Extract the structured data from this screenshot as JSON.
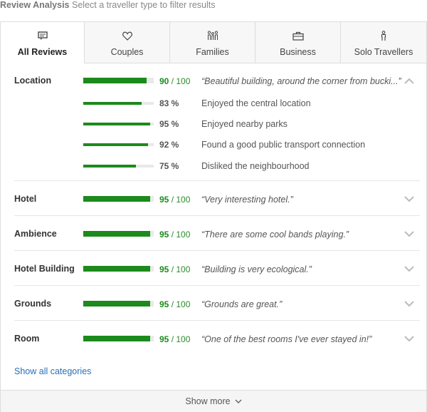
{
  "heading": {
    "title": "Review Analysis",
    "subtitle": "Select a traveller type to filter results"
  },
  "tabs": [
    {
      "label": "All Reviews",
      "icon": "review-icon",
      "active": true
    },
    {
      "label": "Couples",
      "icon": "heart-icon",
      "active": false
    },
    {
      "label": "Families",
      "icon": "family-icon",
      "active": false
    },
    {
      "label": "Business",
      "icon": "briefcase-icon",
      "active": false
    },
    {
      "label": "Solo Travellers",
      "icon": "person-icon",
      "active": false
    }
  ],
  "categories": [
    {
      "name": "Location",
      "score": "90",
      "max": "/ 100",
      "quote": "“Beautiful building, around the corner from bucki...”",
      "expanded": true,
      "subs": [
        {
          "pct": "83 %",
          "value": 83,
          "text": "Enjoyed the central location"
        },
        {
          "pct": "95 %",
          "value": 95,
          "text": "Enjoyed nearby parks"
        },
        {
          "pct": "92 %",
          "value": 92,
          "text": "Found a good public transport connection"
        },
        {
          "pct": "75 %",
          "value": 75,
          "text": "Disliked the neighbourhood"
        }
      ]
    },
    {
      "name": "Hotel",
      "score": "95",
      "max": "/ 100",
      "quote": "“Very interesting hotel.”",
      "expanded": false
    },
    {
      "name": "Ambience",
      "score": "95",
      "max": "/ 100",
      "quote": "“There are some cool bands playing.”",
      "expanded": false
    },
    {
      "name": "Hotel Building",
      "score": "95",
      "max": "/ 100",
      "quote": "“Building is very ecological.”",
      "expanded": false
    },
    {
      "name": "Grounds",
      "score": "95",
      "max": "/ 100",
      "quote": "“Grounds are great.”",
      "expanded": false
    },
    {
      "name": "Room",
      "score": "95",
      "max": "/ 100",
      "quote": "“One of the best rooms I've ever stayed in!”",
      "expanded": false
    }
  ],
  "show_all": "Show all categories",
  "show_more": "Show more",
  "colors": {
    "bar_fill": "#1c8a1c",
    "bar_track": "#e9e9e9",
    "link": "#2a6fb5"
  }
}
